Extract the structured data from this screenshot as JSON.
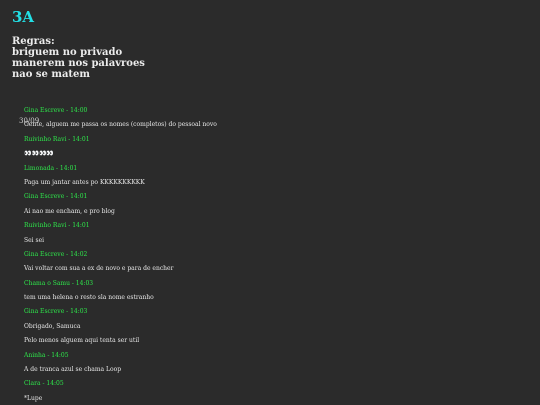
{
  "header": {
    "title": "3A",
    "title_color": "#22e0e6"
  },
  "rules": {
    "heading": "Regras:",
    "items": [
      "briguem no privado",
      "manerem nos palavroes",
      "nao se matem"
    ]
  },
  "chat": {
    "date": "30/09",
    "author_color": "#2ee84b",
    "messages": [
      {
        "author": "Gina Escreve - 14:00",
        "text": "Gente, alguem me passa os nomes (completos) do pessoal novo"
      },
      {
        "author": "Ruivinho Ravi - 14:01",
        "text": "👀👀👀👀"
      },
      {
        "author": "Limonada - 14:01",
        "text": "Paga um jantar antes po KKKKKKKKKK"
      },
      {
        "author": "Gina Escreve - 14:01",
        "text": "Ai nao me encham, e pro blog"
      },
      {
        "author": "Ruivinho Ravi - 14:01",
        "text": "Sei sei"
      },
      {
        "author": "Gina Escreve - 14:02",
        "text": "Vai voltar com sua a ex de novo e para de encher"
      },
      {
        "author": "Chama o Samu - 14:03",
        "text": "tem uma helena o resto sla nome estranho"
      },
      {
        "author": "Gina Escreve - 14:03",
        "text": "Obrigado, Samuca"
      },
      {
        "author": "",
        "text": "Pelo menos alguem aqui tenta ser util"
      },
      {
        "author": "Aninha - 14:05",
        "text": "A de tranca azul se chama Loop"
      },
      {
        "author": "Clara - 14:05",
        "text": "*Lupe"
      }
    ]
  }
}
